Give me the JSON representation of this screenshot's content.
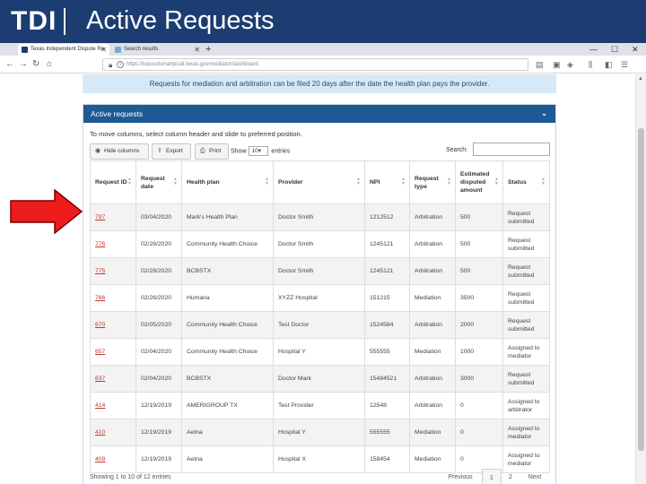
{
  "slide": {
    "logo": "TDI",
    "title": "Active Requests"
  },
  "browser": {
    "tabs": [
      {
        "label": "Texas Independent Dispute Re"
      },
      {
        "label": "Search results"
      }
    ],
    "tab_close": "✕",
    "new_tab": "+",
    "window_controls": [
      "—",
      "☐",
      "✕"
    ],
    "url": "https://txpcostsmartpcall.texas.gov/mediator/dashboard"
  },
  "page": {
    "notice": "Requests for mediation and arbitration can be filed 20 days after the date the health plan pays the provider.",
    "panel_title": "Active requests",
    "instructions": "To move columns, select column header and slide to preferred position.",
    "buttons": {
      "hide_columns": "Hide columns",
      "export": "Export",
      "print": "Print"
    },
    "show_label": "Show",
    "show_value": "10",
    "entries_label": "entries",
    "search_label": "Search:",
    "columns": [
      "Request ID",
      "Request date",
      "Health plan",
      "Provider",
      "NPI",
      "Request type",
      "Estimated disputed amount",
      "Status"
    ],
    "rows": [
      [
        "797",
        "03/04/2020",
        "Mark's Health Plan",
        "Doctor Smith",
        "1212512",
        "Arbitration",
        "500",
        "Request submitted"
      ],
      [
        "776",
        "02/28/2020",
        "Community Health Choice",
        "Doctor Smith",
        "1245121",
        "Arbitration",
        "500",
        "Request submitted"
      ],
      [
        "775",
        "02/28/2020",
        "BCBSTX",
        "Doctor Smith",
        "1245121",
        "Arbitration",
        "500",
        "Request submitted"
      ],
      [
        "766",
        "02/26/2020",
        "Humana",
        "XYZZ Hospital",
        "151215",
        "Mediation",
        "3500",
        "Request submitted"
      ],
      [
        "670",
        "02/05/2020",
        "Community Health Choice",
        "Test Doctor",
        "1524584",
        "Arbitration",
        "2000",
        "Request submitted"
      ],
      [
        "657",
        "02/04/2020",
        "Community Health Choice",
        "Hospital Y",
        "555555",
        "Mediation",
        "1000",
        "Assigned to mediator"
      ],
      [
        "637",
        "02/04/2020",
        "BCBSTX",
        "Doctor Mark",
        "15484521",
        "Arbitration",
        "3000",
        "Request submitted"
      ],
      [
        "414",
        "12/19/2019",
        "AMERIGROUP TX",
        "Test Provider",
        "12548",
        "Arbitration",
        "0",
        "Assigned to arbitrator"
      ],
      [
        "410",
        "12/19/2019",
        "Aetna",
        "Hospital Y",
        "555555",
        "Mediation",
        "0",
        "Assigned to mediator"
      ],
      [
        "409",
        "12/19/2019",
        "Aetna",
        "Hospital X",
        "158454",
        "Mediation",
        "0",
        "Assigned to mediator"
      ]
    ],
    "showing": "Showing 1 to 10 of 12 entries",
    "pager": {
      "previous": "Previous",
      "page1": "1",
      "page2": "2",
      "next": "Next"
    }
  },
  "colors": {
    "header_blue": "#1c3d72",
    "panel_blue": "#1e5a96",
    "notice_bg": "#d7e9f7",
    "link_red": "#c0392b",
    "arrow_red": "#ee1c1c"
  }
}
